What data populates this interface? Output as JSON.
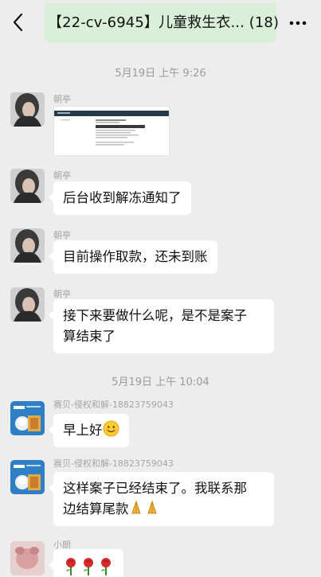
{
  "header": {
    "title": "【22-cv-6945】儿童救生衣... (18)",
    "back_icon": "chevron-left-icon",
    "more_icon": "more-dots-icon"
  },
  "timestamps": [
    "5月19日 上午 9:26",
    "5月19日 上午 10:04"
  ],
  "messages": [
    {
      "sender": "朝亭",
      "type": "image",
      "icon": "screenshot-thumbnail"
    },
    {
      "sender": "朝亭",
      "type": "text",
      "text": "后台收到解冻通知了"
    },
    {
      "sender": "朝亭",
      "type": "text",
      "text": "目前操作取款，还未到账"
    },
    {
      "sender": "朝亭",
      "type": "text",
      "line1": "接下来要做什么呢，是不是案子",
      "line2": "算结束了"
    },
    {
      "sender": "赛贝-侵权和解-18823759043",
      "type": "text",
      "text": "早上好",
      "emoji": "smiling-face-icon"
    },
    {
      "sender": "赛贝-侵权和解-18823759043",
      "type": "text",
      "line1": "这样案子已经结束了。我联系那",
      "line2": "边结算尾款",
      "emoji": "praying-hands-icon"
    },
    {
      "sender": "小朗",
      "type": "text",
      "emoji": "rose-icon"
    }
  ],
  "colors": {
    "background": "#ededed",
    "bubble": "#ffffff",
    "title_highlight": "#d9efd8"
  }
}
